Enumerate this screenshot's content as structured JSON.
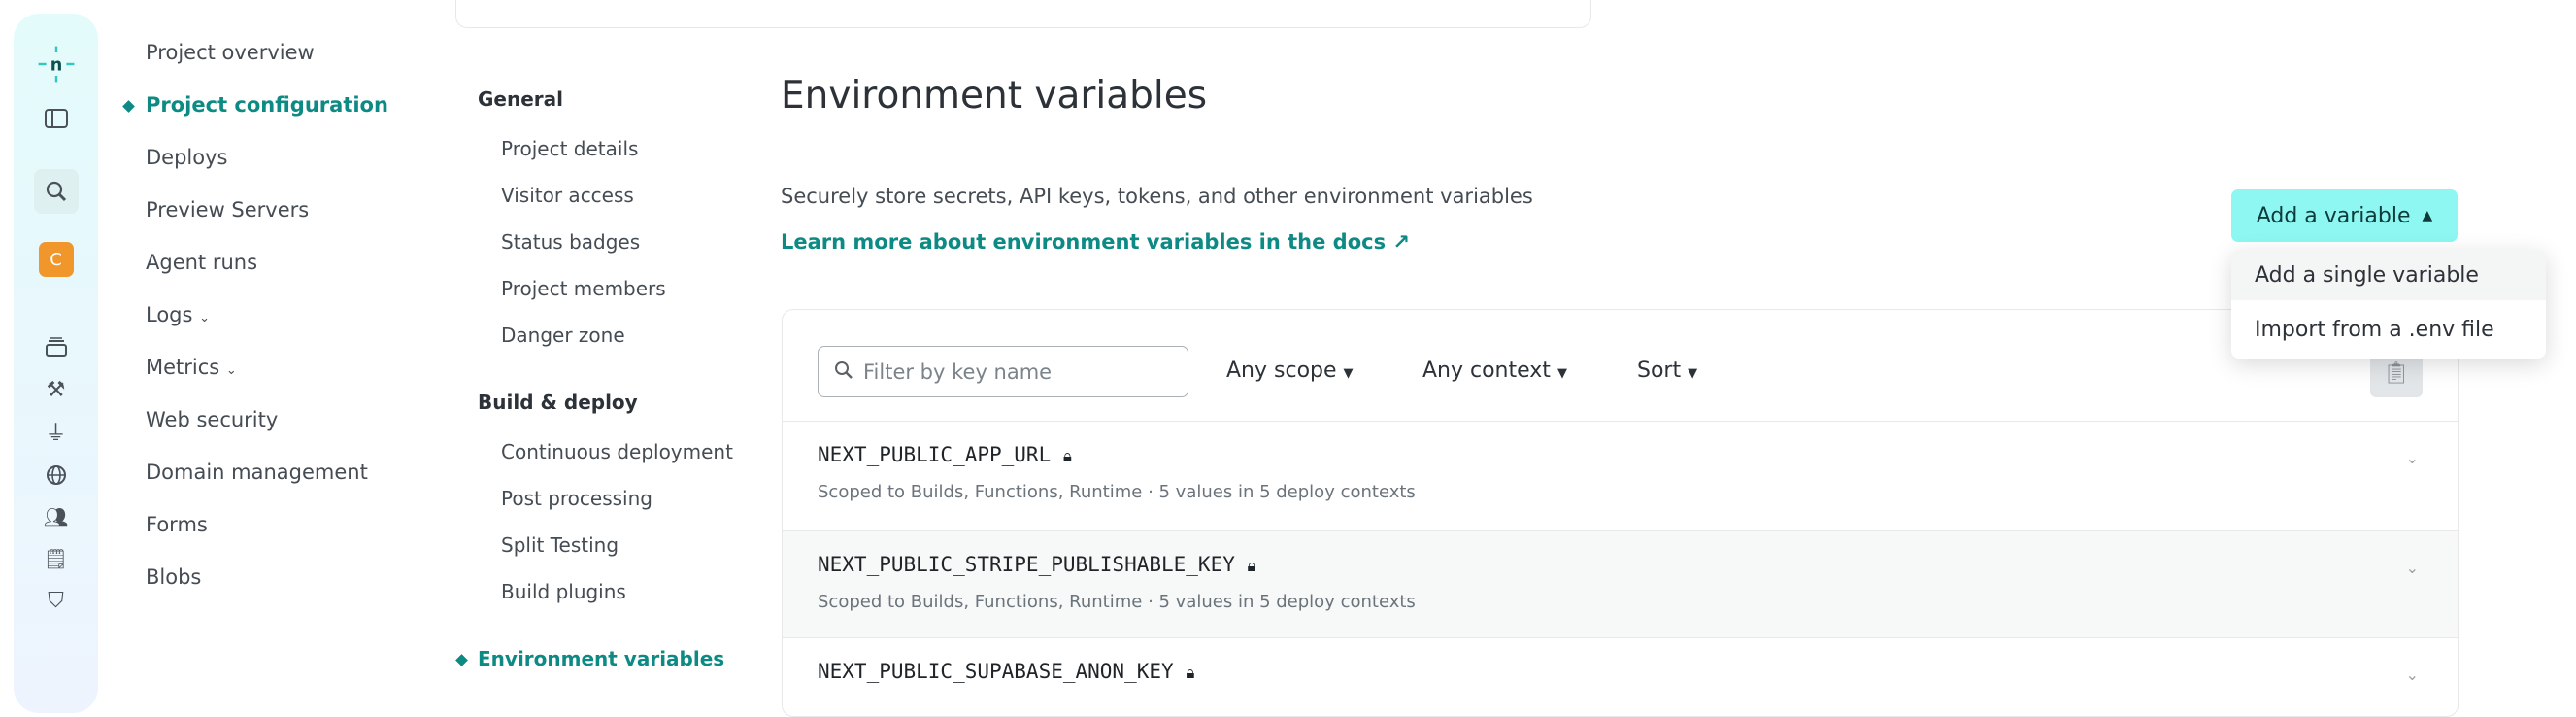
{
  "rail": {
    "icons": [
      "netlify-logo-icon",
      "sidebar-toggle-icon",
      "search-icon",
      "team-avatar",
      "layers-icon",
      "hammer-icon",
      "plug-icon",
      "globe-icon",
      "users-icon",
      "billing-icon",
      "shield-icon"
    ],
    "avatar_letter": "C",
    "avatar_color": "#f0962a"
  },
  "nav": {
    "items": [
      {
        "label": "Project overview"
      },
      {
        "label": "Project configuration",
        "active": true
      },
      {
        "label": "Deploys"
      },
      {
        "label": "Preview Servers"
      },
      {
        "label": "Agent runs"
      },
      {
        "label": "Logs",
        "caret": true
      },
      {
        "label": "Metrics",
        "caret": true
      },
      {
        "label": "Web security"
      },
      {
        "label": "Domain management"
      },
      {
        "label": "Forms"
      },
      {
        "label": "Blobs"
      }
    ]
  },
  "settings_nav": {
    "general": {
      "heading": "General",
      "items": [
        "Project details",
        "Visitor access",
        "Status badges",
        "Project members",
        "Danger zone"
      ]
    },
    "build": {
      "heading": "Build & deploy",
      "items": [
        "Continuous deployment",
        "Post processing",
        "Split Testing",
        "Build plugins"
      ]
    },
    "active": "Environment variables"
  },
  "main": {
    "title": "Environment variables",
    "description": "Securely store secrets, API keys, tokens, and other environment variables",
    "docs_link": "Learn more about environment variables in the docs ↗",
    "add_button": "Add a variable",
    "menu": [
      "Add a single variable",
      "Import from a .env file"
    ]
  },
  "filters": {
    "search_placeholder": "Filter by key name",
    "scope": "Any scope",
    "context": "Any context",
    "sort": "Sort"
  },
  "variables": [
    {
      "key": "NEXT_PUBLIC_APP_URL",
      "meta": "Scoped to Builds, Functions, Runtime  ·  5 values in 5 deploy contexts"
    },
    {
      "key": "NEXT_PUBLIC_STRIPE_PUBLISHABLE_KEY",
      "meta": "Scoped to Builds, Functions, Runtime  ·  5 values in 5 deploy contexts"
    },
    {
      "key": "NEXT_PUBLIC_SUPABASE_ANON_KEY",
      "meta": ""
    }
  ],
  "colors": {
    "accent": "#0e8a85",
    "button": "#8ef7f2"
  }
}
